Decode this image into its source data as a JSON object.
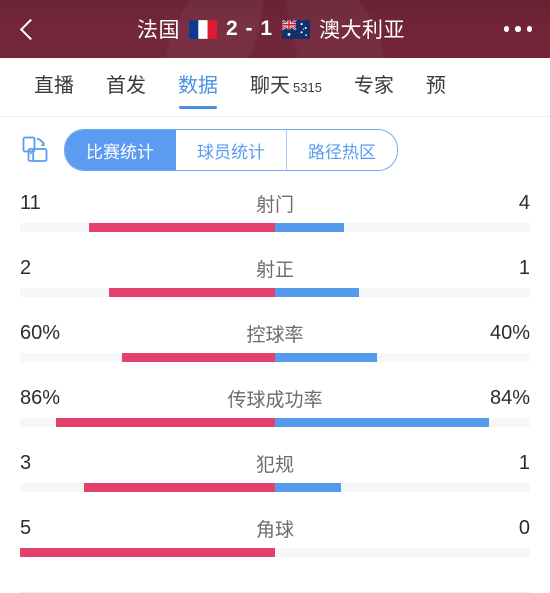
{
  "header": {
    "back_icon": "chevron-left-icon",
    "home_team": "法国",
    "away_team": "澳大利亚",
    "score": "2 - 1",
    "home_flag": "france-flag",
    "away_flag": "australia-flag",
    "more_icon": "more-options-icon",
    "bg_color": "#6b1b2f"
  },
  "tabs": {
    "items": [
      {
        "label": "直播",
        "badge": "",
        "active": false
      },
      {
        "label": "首发",
        "badge": "",
        "active": false
      },
      {
        "label": "数据",
        "badge": "",
        "active": true
      },
      {
        "label": "聊天",
        "badge": "5315",
        "active": false
      },
      {
        "label": "专家",
        "badge": "",
        "active": false
      },
      {
        "label": "预",
        "badge": "",
        "active": false
      }
    ],
    "active_color": "#4a90e2"
  },
  "subbar": {
    "rotate_icon": "rotate-screen-icon",
    "segments": [
      {
        "label": "比赛统计",
        "active": true
      },
      {
        "label": "球员统计",
        "active": false
      },
      {
        "label": "路径热区",
        "active": false
      }
    ],
    "accent_color": "#5b9bf0"
  },
  "chart_data": {
    "type": "bar",
    "title": "比赛统计",
    "orientation": "horizontal-diverging",
    "home_color": "#e3416b",
    "away_color": "#559bec",
    "track_color": "#f6f7f9",
    "max_half_width_pct": 50,
    "categories": [
      "射门",
      "射正",
      "控球率",
      "传球成功率",
      "犯规",
      "角球"
    ],
    "series": [
      {
        "name": "法国",
        "side": "left",
        "values": [
          "11",
          "2",
          "60%",
          "86%",
          "3",
          "5"
        ],
        "fill_pct": [
          73,
          65,
          60,
          86,
          75,
          100
        ]
      },
      {
        "name": "澳大利亚",
        "side": "right",
        "values": [
          "4",
          "1",
          "40%",
          "84%",
          "1",
          "0"
        ],
        "fill_pct": [
          27,
          33,
          40,
          84,
          26,
          0
        ]
      }
    ],
    "rows": [
      {
        "label": "射门",
        "home": "11",
        "away": "4",
        "home_pct": 73,
        "away_pct": 27
      },
      {
        "label": "射正",
        "home": "2",
        "away": "1",
        "home_pct": 65,
        "away_pct": 33
      },
      {
        "label": "控球率",
        "home": "60%",
        "away": "40%",
        "home_pct": 60,
        "away_pct": 40
      },
      {
        "label": "传球成功率",
        "home": "86%",
        "away": "84%",
        "home_pct": 86,
        "away_pct": 84
      },
      {
        "label": "犯规",
        "home": "3",
        "away": "1",
        "home_pct": 75,
        "away_pct": 26
      },
      {
        "label": "角球",
        "home": "5",
        "away": "0",
        "home_pct": 100,
        "away_pct": 0
      }
    ]
  }
}
